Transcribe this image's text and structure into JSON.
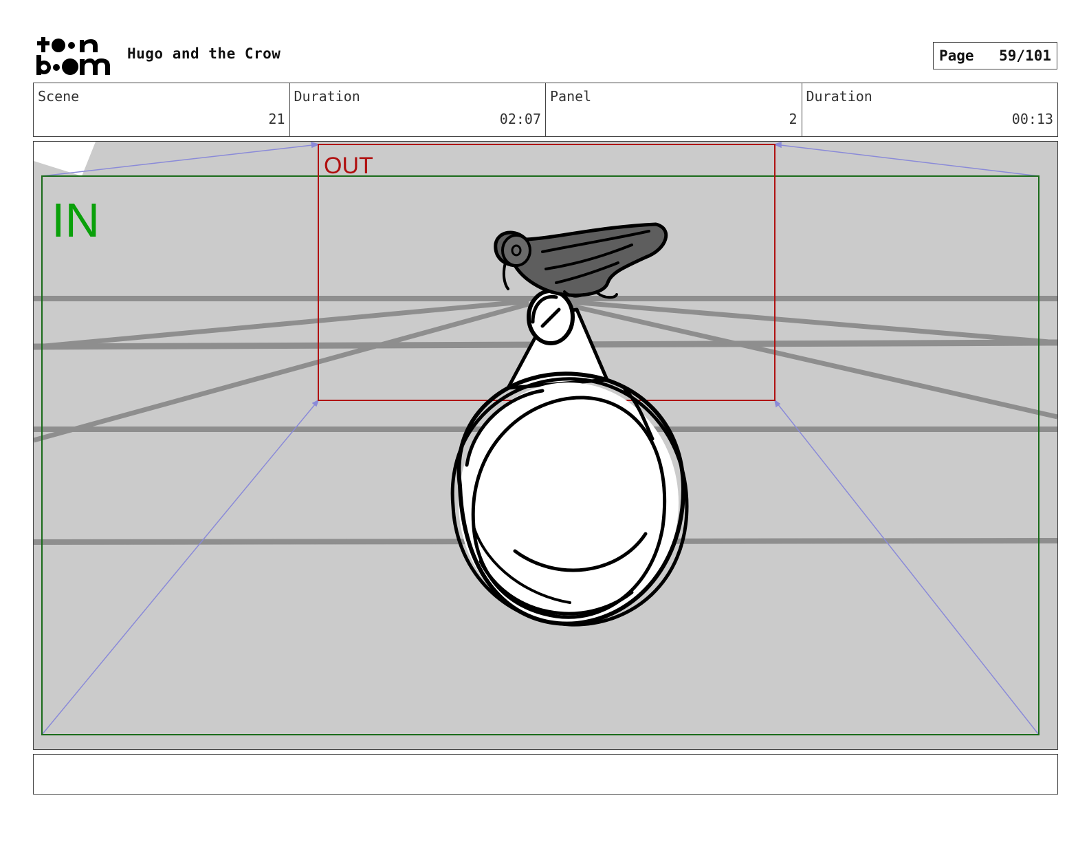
{
  "header": {
    "project_title": "Hugo and the Crow",
    "page_label": "Page",
    "page_number": "59/101"
  },
  "info": {
    "scene_label": "Scene",
    "scene_value": "21",
    "scene_duration_label": "Duration",
    "scene_duration_value": "02:07",
    "panel_label": "Panel",
    "panel_value": "2",
    "panel_duration_label": "Duration",
    "panel_duration_value": "00:13"
  },
  "panel": {
    "in_label": "IN",
    "out_label": "OUT",
    "colors": {
      "background": "#cbcbcb",
      "in_frame": "#1a6b1a",
      "in_text": "#0aa00a",
      "out_frame": "#b01010",
      "out_text": "#b01010",
      "camera_path": "#8a8ad8",
      "perspective_lines": "#8e8e8e",
      "crow": "#5e5e5e"
    }
  },
  "notes": {
    "text": ""
  }
}
